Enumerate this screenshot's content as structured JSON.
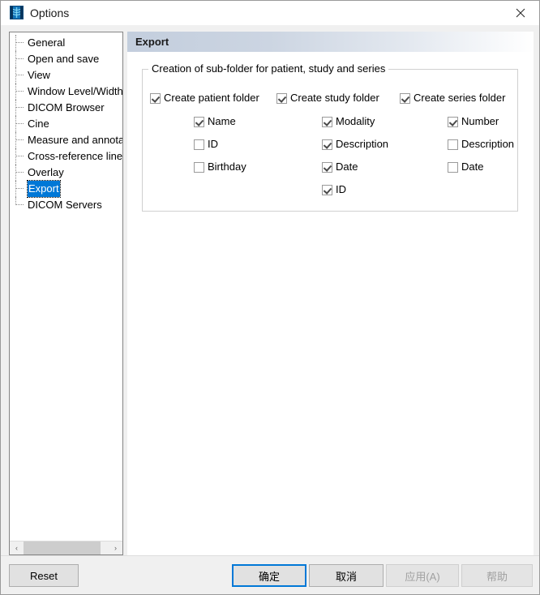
{
  "window": {
    "title": "Options",
    "icon": "xray-thumbnail-icon",
    "close_icon": "close-icon"
  },
  "sidebar": {
    "items": [
      {
        "label": "General",
        "selected": false
      },
      {
        "label": "Open and save",
        "selected": false
      },
      {
        "label": "View",
        "selected": false
      },
      {
        "label": "Window Level/Width",
        "selected": false
      },
      {
        "label": "DICOM Browser",
        "selected": false
      },
      {
        "label": "Cine",
        "selected": false
      },
      {
        "label": "Measure and annotation",
        "selected": false
      },
      {
        "label": "Cross-reference line",
        "selected": false
      },
      {
        "label": "Overlay",
        "selected": false
      },
      {
        "label": "Export",
        "selected": true
      },
      {
        "label": "DICOM Servers",
        "selected": false
      }
    ],
    "scrollbar": {
      "left_arrow": "‹",
      "right_arrow": "›"
    }
  },
  "page": {
    "title": "Export",
    "groupbox": {
      "title": "Creation of sub-folder for patient, study and series",
      "columns": [
        {
          "header": {
            "label": "Create patient folder",
            "checked": true
          },
          "options": [
            {
              "label": "Name",
              "checked": true
            },
            {
              "label": "ID",
              "checked": false
            },
            {
              "label": "Birthday",
              "checked": false
            }
          ]
        },
        {
          "header": {
            "label": "Create study folder",
            "checked": true
          },
          "options": [
            {
              "label": "Modality",
              "checked": true
            },
            {
              "label": "Description",
              "checked": true
            },
            {
              "label": "Date",
              "checked": true
            },
            {
              "label": "ID",
              "checked": true
            }
          ]
        },
        {
          "header": {
            "label": "Create series folder",
            "checked": true
          },
          "options": [
            {
              "label": "Number",
              "checked": true
            },
            {
              "label": "Description",
              "checked": false
            },
            {
              "label": "Date",
              "checked": false
            }
          ]
        }
      ]
    }
  },
  "buttons": {
    "reset": "Reset",
    "ok": "确定",
    "cancel": "取消",
    "apply": "应用(A)",
    "help": "帮助"
  },
  "colors": {
    "accent": "#0078d7",
    "dialog_bg": "#f0f0f0",
    "panel_bg": "#ffffff",
    "header_gradient_start": "#c3cedd"
  }
}
